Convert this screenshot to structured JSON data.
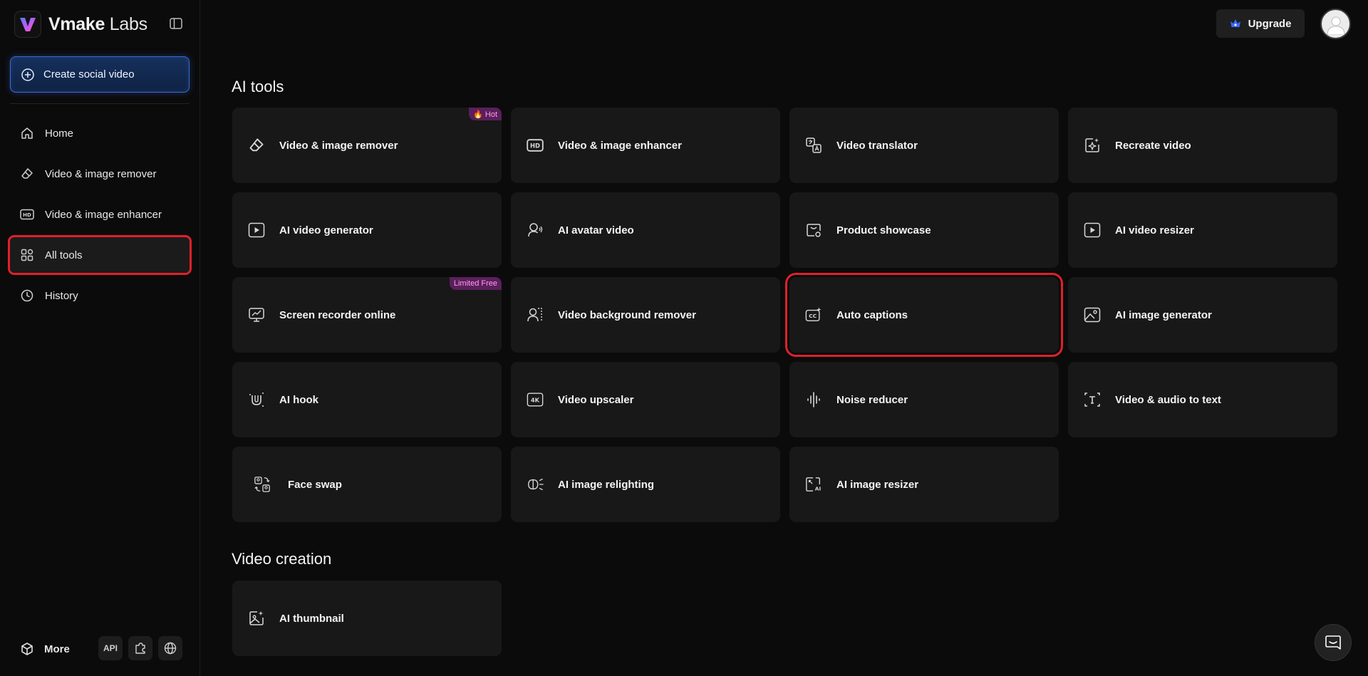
{
  "brand": {
    "name_bold": "Vmake",
    "name_light": " Labs"
  },
  "sidebar": {
    "create_label": "Create social video",
    "items": [
      {
        "label": "Home",
        "icon": "home-icon"
      },
      {
        "label": "Video & image remover",
        "icon": "eraser-icon"
      },
      {
        "label": "Video & image enhancer",
        "icon": "hd-icon"
      },
      {
        "label": "All tools",
        "icon": "grid-icon",
        "active": true
      },
      {
        "label": "History",
        "icon": "clock-icon"
      }
    ],
    "more_label": "More",
    "api_label": "API"
  },
  "header": {
    "upgrade_label": "Upgrade"
  },
  "sections": {
    "ai_tools_title": "AI tools",
    "video_creation_title": "Video creation"
  },
  "tools": [
    {
      "label": "Video & image remover",
      "icon": "eraser-icon",
      "badge": "🔥 Hot"
    },
    {
      "label": "Video & image enhancer",
      "icon": "hd-icon"
    },
    {
      "label": "Video translator",
      "icon": "translate-icon"
    },
    {
      "label": "Recreate video",
      "icon": "sparkle-doc-icon"
    },
    {
      "label": "AI video generator",
      "icon": "play-box-icon"
    },
    {
      "label": "AI avatar video",
      "icon": "avatar-icon"
    },
    {
      "label": "Product showcase",
      "icon": "product-icon"
    },
    {
      "label": "AI video resizer",
      "icon": "play-box-icon"
    },
    {
      "label": "Screen recorder online",
      "icon": "screen-recorder-icon",
      "badge": "Limited Free"
    },
    {
      "label": "Video background remover",
      "icon": "person-bg-icon"
    },
    {
      "label": "Auto captions",
      "icon": "cc-icon"
    },
    {
      "label": "AI image generator",
      "icon": "image-icon"
    },
    {
      "label": "AI hook",
      "icon": "magnet-icon"
    },
    {
      "label": "Video upscaler",
      "icon": "4k-icon"
    },
    {
      "label": "Noise reducer",
      "icon": "waveform-icon"
    },
    {
      "label": "Video & audio to text",
      "icon": "text-icon"
    },
    {
      "label": "Face swap",
      "icon": "face-swap-icon"
    },
    {
      "label": "AI image relighting",
      "icon": "relight-icon"
    },
    {
      "label": "AI image resizer",
      "icon": "image-resize-icon"
    }
  ],
  "video_creation": [
    {
      "label": "AI thumbnail",
      "icon": "thumbnail-icon"
    }
  ],
  "colors": {
    "accent_blue": "#3c6bd3",
    "highlight_red": "#e0202a",
    "card_bg": "#181818",
    "badge_bg": "#5a1f5c"
  }
}
